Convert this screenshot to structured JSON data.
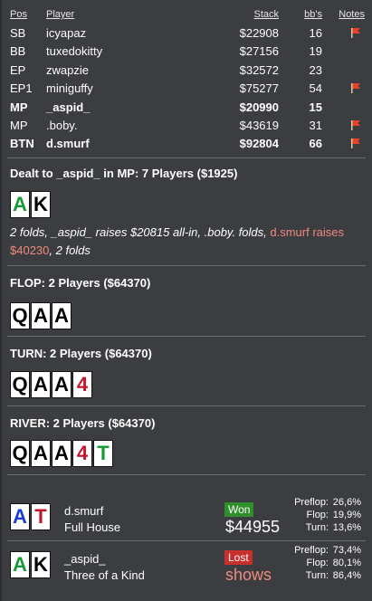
{
  "table": {
    "headers": {
      "pos": "Pos",
      "player": "Player",
      "stack": "Stack",
      "bbs": "bb's",
      "notes": "Notes"
    },
    "rows": [
      {
        "pos": "SB",
        "player": "icyapaz",
        "stack": "$22908",
        "bbs": "16",
        "flag": true,
        "bold": false
      },
      {
        "pos": "BB",
        "player": "tuxedokitty",
        "stack": "$27156",
        "bbs": "19",
        "flag": false,
        "bold": false
      },
      {
        "pos": "EP",
        "player": "zwapzie",
        "stack": "$32572",
        "bbs": "23",
        "flag": false,
        "bold": false
      },
      {
        "pos": "EP1",
        "player": "miniguffy",
        "stack": "$75277",
        "bbs": "54",
        "flag": true,
        "bold": false
      },
      {
        "pos": "MP",
        "player": "_aspid_",
        "stack": "$20990",
        "bbs": "15",
        "flag": false,
        "bold": true
      },
      {
        "pos": "MP",
        "player": ".boby.",
        "stack": "$43619",
        "bbs": "31",
        "flag": true,
        "bold": false
      },
      {
        "pos": "BTN",
        "player": "d.smurf",
        "stack": "$92804",
        "bbs": "66",
        "flag": true,
        "bold": true
      }
    ]
  },
  "preflop": {
    "title": "Dealt to _aspid_ in MP: 7 Players ($1925)",
    "cards": [
      {
        "rank": "A",
        "suit": "green"
      },
      {
        "rank": "K",
        "suit": "black"
      }
    ],
    "actions_1": "2 folds, _aspid_ raises $20815 all-in, .boby. folds, ",
    "actions_red": "d.smurf raises $40230",
    "actions_2": ", 2 folds"
  },
  "flop": {
    "title": "FLOP: 2 Players ($64370)",
    "cards": [
      {
        "rank": "Q",
        "suit": "black"
      },
      {
        "rank": "A",
        "suit": "black"
      },
      {
        "rank": "A",
        "suit": "black"
      }
    ]
  },
  "turn": {
    "title": "TURN: 2 Players ($64370)",
    "cards": [
      {
        "rank": "Q",
        "suit": "black"
      },
      {
        "rank": "A",
        "suit": "black"
      },
      {
        "rank": "A",
        "suit": "black"
      },
      {
        "rank": "4",
        "suit": "red"
      }
    ]
  },
  "river": {
    "title": "RIVER: 2 Players ($64370)",
    "cards": [
      {
        "rank": "Q",
        "suit": "black"
      },
      {
        "rank": "A",
        "suit": "black"
      },
      {
        "rank": "A",
        "suit": "black"
      },
      {
        "rank": "4",
        "suit": "red"
      },
      {
        "rank": "T",
        "suit": "green"
      }
    ]
  },
  "results": [
    {
      "player": "d.smurf",
      "hand": "Full House",
      "cards": [
        {
          "rank": "A",
          "suit": "blue"
        },
        {
          "rank": "T",
          "suit": "red"
        }
      ],
      "badge": "Won",
      "badge_type": "won",
      "amount": "$44955",
      "equity": [
        {
          "label": "Preflop:",
          "value": "26,6%"
        },
        {
          "label": "Flop:",
          "value": "19,9%"
        },
        {
          "label": "Turn:",
          "value": "13,6%"
        }
      ]
    },
    {
      "player": "_aspid_",
      "hand": "Three of a Kind",
      "cards": [
        {
          "rank": "A",
          "suit": "green"
        },
        {
          "rank": "K",
          "suit": "black"
        }
      ],
      "badge": "Lost",
      "badge_type": "lost",
      "amount": "shows",
      "equity": [
        {
          "label": "Preflop:",
          "value": "73,4%"
        },
        {
          "label": "Flop:",
          "value": "80,1%"
        },
        {
          "label": "Turn:",
          "value": "86,4%"
        }
      ]
    }
  ],
  "colors": {
    "background": "#3b3d40",
    "suit_black": "#000000",
    "suit_green": "#1a9a36",
    "suit_blue": "#1a3fd0",
    "suit_red": "#c8142a",
    "highlight_text": "#f08a80",
    "won_badge": "#2f8f2c",
    "lost_badge": "#c8302c",
    "flag": "#e8412a"
  }
}
